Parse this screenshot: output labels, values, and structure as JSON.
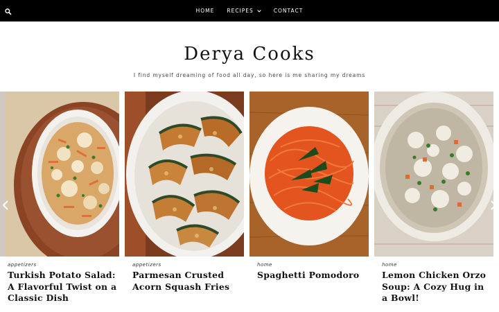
{
  "header": {
    "search_icon": "search-icon",
    "nav": [
      {
        "label": "HOME",
        "has_dropdown": false
      },
      {
        "label": "RECIPES",
        "has_dropdown": true
      },
      {
        "label": "CONTACT",
        "has_dropdown": false
      }
    ]
  },
  "site": {
    "title": "Derya Cooks",
    "tagline": "I find myself dreaming of food all day, so here is me sharing my dreams"
  },
  "carousel": {
    "prev_icon": "chevron-left-icon",
    "next_icon": "chevron-right-icon",
    "cards": [
      {
        "category": "appetizers",
        "title": "Turkish Potato Salad: A Flavorful Twist on a Classic Dish"
      },
      {
        "category": "appetizers",
        "title": "Parmesan Crusted Acorn Squash Fries"
      },
      {
        "category": "home",
        "title": "Spaghetti Pomodoro"
      },
      {
        "category": "home",
        "title": "Lemon Chicken Orzo Soup: A Cozy Hug in a Bowl!"
      }
    ]
  },
  "colors": {
    "topbar": "#000000",
    "text": "#111111"
  }
}
